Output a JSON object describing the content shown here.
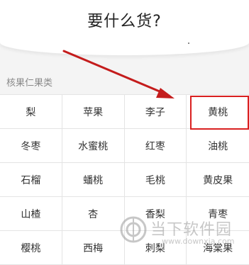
{
  "header": {
    "title": "要什么货?"
  },
  "category": {
    "label": "核果仁果类"
  },
  "fruits": [
    "梨",
    "苹果",
    "李子",
    "黄桃",
    "冬枣",
    "水蜜桃",
    "红枣",
    "油桃",
    "石榴",
    "蟠桃",
    "毛桃",
    "黄皮果",
    "山楂",
    "杏",
    "香梨",
    "青枣",
    "樱桃",
    "西梅",
    "刺梨",
    "海棠果"
  ],
  "highlighted_item": "黄桃",
  "watermark": {
    "text": "当下软件园",
    "url": "www.downxia.com"
  },
  "colors": {
    "annotation_red": "#d92020"
  }
}
